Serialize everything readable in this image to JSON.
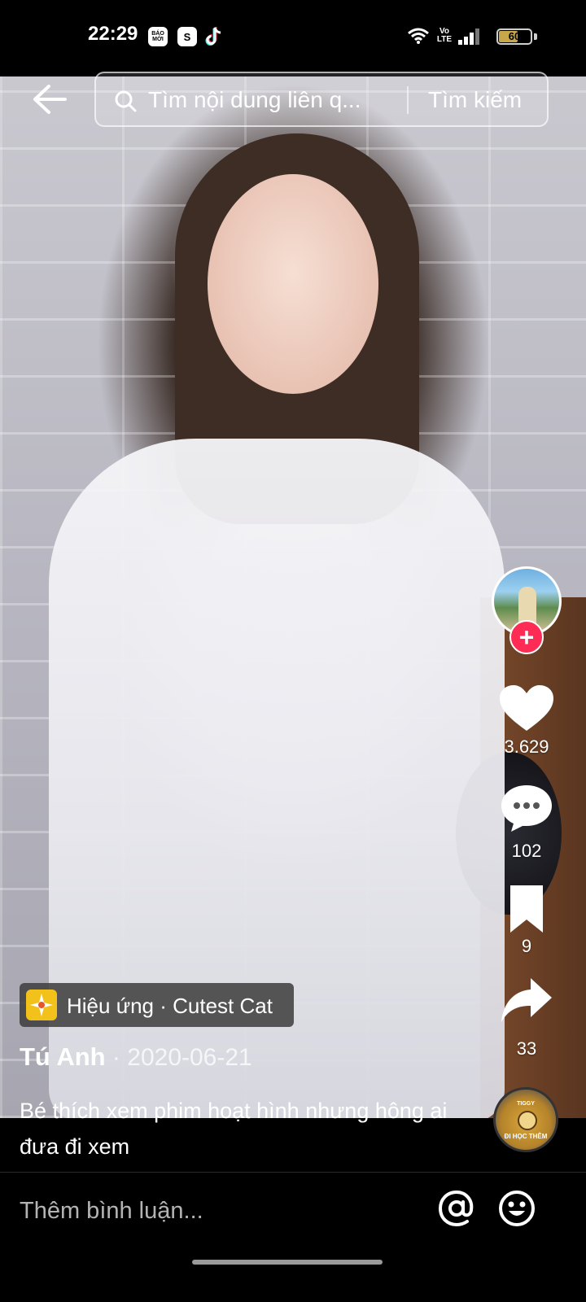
{
  "status_bar": {
    "time": "22:29",
    "notification_apps": [
      "BÁO MỚI",
      "S",
      "TikTok"
    ],
    "network": "Vo LTE",
    "battery_level": "60",
    "icons": [
      "wifi-icon",
      "signal-icon",
      "battery-icon"
    ]
  },
  "header": {
    "search_placeholder": "Tìm nội dung liên q...",
    "search_button": "Tìm kiếm"
  },
  "video": {
    "creator_avatar": "creator-avatar",
    "follow_symbol": "+",
    "likes": "3.629",
    "comments": "102",
    "saves": "9",
    "shares": "33"
  },
  "effect": {
    "label": "Hiệu ứng · Cutest Cat"
  },
  "post": {
    "author": "Tú Anh",
    "separator": " · ",
    "date": "2020-06-21",
    "caption": "Bé thích xem phim hoạt hình nhưng hông ai đưa đi xem"
  },
  "music": {
    "disc_title": "TIGGY",
    "disc_subtitle": "ĐI HỌC THÊM"
  },
  "comment_bar": {
    "placeholder": "Thêm bình luận..."
  },
  "colors": {
    "follow": "#fe2c55",
    "effect_icon": "#f2c21b",
    "background": "#000000"
  }
}
